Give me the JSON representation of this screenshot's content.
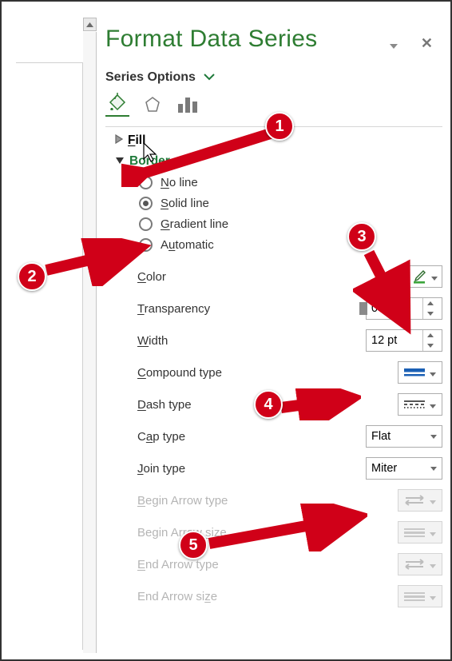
{
  "panel": {
    "title": "Format Data Series",
    "subtitle": "Series Options",
    "sections": {
      "fill": {
        "label": "Fill"
      },
      "border": {
        "label": "Border",
        "options": {
          "no_line": "No line",
          "solid_line": "Solid line",
          "gradient_line": "Gradient line",
          "automatic": "Automatic",
          "selected": "solid_line"
        }
      }
    },
    "controls": {
      "color": {
        "label": "Color"
      },
      "transparency": {
        "label": "Transparency",
        "value": "0%"
      },
      "width": {
        "label": "Width",
        "value": "12 pt"
      },
      "compound_type": {
        "label": "Compound type"
      },
      "dash_type": {
        "label": "Dash type"
      },
      "cap_type": {
        "label": "Cap type",
        "value": "Flat"
      },
      "join_type": {
        "label": "Join type",
        "value": "Miter"
      },
      "begin_arrow_type": {
        "label": "Begin Arrow type"
      },
      "begin_arrow_size": {
        "label": "Begin Arrow size"
      },
      "end_arrow_type": {
        "label": "End Arrow type"
      },
      "end_arrow_size": {
        "label": "End Arrow size"
      }
    }
  },
  "callouts": {
    "1": "1",
    "2": "2",
    "3": "3",
    "4": "4",
    "5": "5"
  }
}
